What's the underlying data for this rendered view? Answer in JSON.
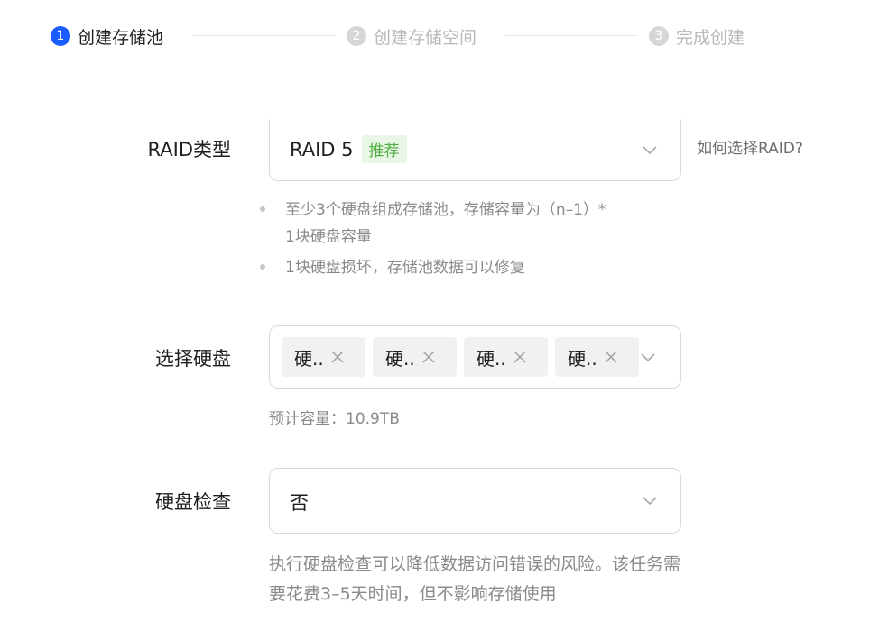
{
  "stepper": {
    "steps": [
      {
        "num": "1",
        "label": "创建存储池",
        "state": "active"
      },
      {
        "num": "2",
        "label": "创建存储空间",
        "state": "inactive"
      },
      {
        "num": "3",
        "label": "完成创建",
        "state": "inactive"
      }
    ]
  },
  "raid": {
    "label": "RAID类型",
    "value": "RAID 5",
    "badge": "推荐",
    "help_link": "如何选择RAID?",
    "hints": {
      "line1a": "至少3个硬盘组成存储池，存储容量为（n–1）*",
      "line1b": "1块硬盘容量",
      "line2": "1块硬盘损坏，存储池数据可以修复"
    }
  },
  "disks": {
    "label": "选择硬盘",
    "tags": [
      "硬..",
      "硬..",
      "硬..",
      "硬.."
    ],
    "capacity": "预计容量：10.9TB"
  },
  "check": {
    "label": "硬盘检查",
    "value": "否",
    "description": "执行硬盘检查可以降低数据访问错误的风险。该任务需要花费3–5天时间，但不影响存储使用"
  },
  "colors": {
    "accent": "#1a5cff",
    "badge_bg": "#e9f6e6",
    "badge_text": "#4caf3f"
  }
}
